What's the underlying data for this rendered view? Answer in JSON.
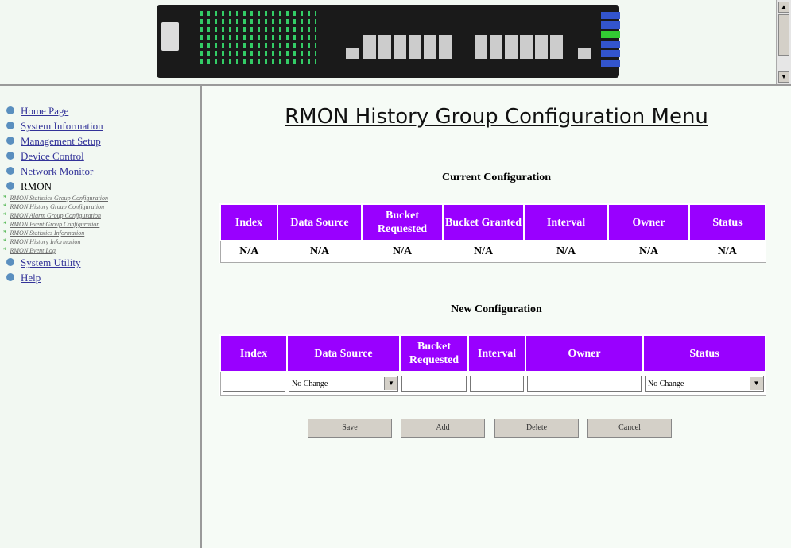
{
  "nav": {
    "items": [
      {
        "label": "Home Page"
      },
      {
        "label": "System Information"
      },
      {
        "label": "Management Setup"
      },
      {
        "label": "Device Control"
      },
      {
        "label": "Network Monitor"
      },
      {
        "label": "RMON"
      }
    ],
    "sub_items": [
      {
        "label": "RMON Statistics Group Configuration"
      },
      {
        "label": "RMON History Group Configuration"
      },
      {
        "label": "RMON Alarm Group Configuration"
      },
      {
        "label": "RMON Event Group Configuration"
      },
      {
        "label": "RMON Statistics Information"
      },
      {
        "label": "RMON History Information"
      },
      {
        "label": "RMON Event Log"
      }
    ],
    "after_items": [
      {
        "label": "System Utility"
      },
      {
        "label": "Help"
      }
    ]
  },
  "page": {
    "title": "RMON History Group Configuration Menu"
  },
  "current": {
    "heading": "Current Configuration",
    "headers": [
      "Index",
      "Data Source",
      "Bucket Requested",
      "Bucket Granted",
      "Interval",
      "Owner",
      "Status"
    ],
    "values": [
      "N/A",
      "N/A",
      "N/A",
      "N/A",
      "N/A",
      "N/A",
      "N/A"
    ]
  },
  "new_config": {
    "heading": "New Configuration",
    "headers": [
      "Index",
      "Data Source",
      "Bucket Requested",
      "Interval",
      "Owner",
      "Status"
    ],
    "data_source_value": "No Change",
    "status_value": "No Change"
  },
  "buttons": {
    "save": "Save",
    "add": "Add",
    "delete": "Delete",
    "cancel": "Cancel"
  },
  "colors": {
    "header_bg": "#9900ff",
    "link": "#333399"
  }
}
